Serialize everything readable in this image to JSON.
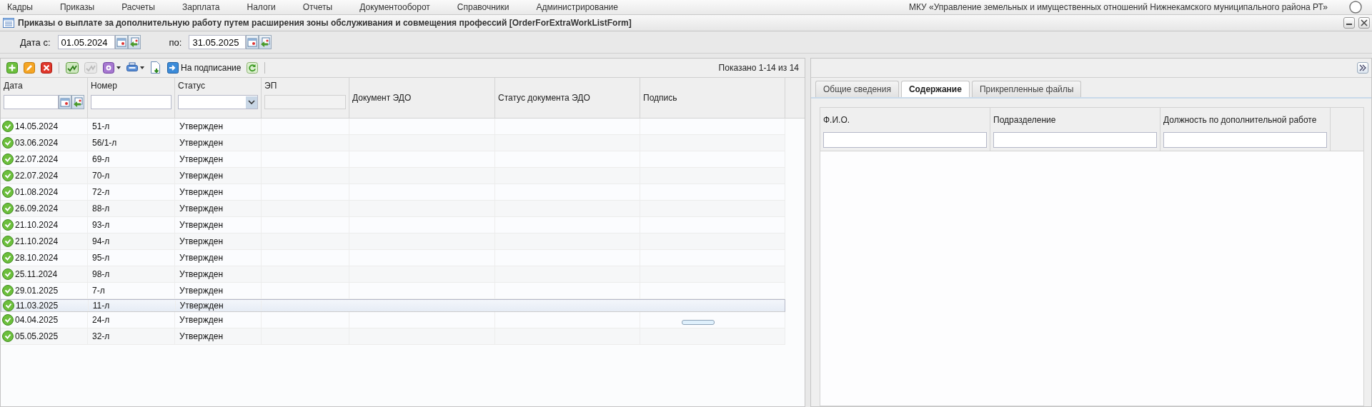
{
  "menu": [
    "Кадры",
    "Приказы",
    "Расчеты",
    "Зарплата",
    "Налоги",
    "Отчеты",
    "Документооборот",
    "Справочники",
    "Администрирование"
  ],
  "organization": "МКУ «Управление земельных и имущественных отношений Нижнекамского муниципального района РТ»",
  "window": {
    "title": "Приказы о выплате за дополнительную работу путем расширения зоны обслуживания и совмещения профессий [OrderForExtraWorkListForm]"
  },
  "filter": {
    "from_label": "Дата с:",
    "from": "01.05.2024",
    "to_label": "по:",
    "to": "31.05.2025"
  },
  "toolbar": [
    {
      "kind": "add",
      "disabled": false
    },
    {
      "kind": "edit",
      "disabled": false
    },
    {
      "kind": "delete",
      "disabled": false
    },
    {
      "kind": "separator"
    },
    {
      "kind": "sign",
      "disabled": false
    },
    {
      "kind": "sign",
      "disabled": true
    },
    {
      "kind": "settings",
      "disabled": false,
      "dropdown": true
    },
    {
      "kind": "print",
      "disabled": false,
      "dropdown": true
    },
    {
      "kind": "export",
      "disabled": false
    },
    {
      "kind": "send",
      "disabled": false,
      "label": "На подписание"
    },
    {
      "kind": "refresh",
      "disabled": false
    },
    {
      "kind": "separator"
    }
  ],
  "paging": "Показано 1-14 из 14",
  "table": {
    "columns": [
      {
        "label": "Дата",
        "kind": "date"
      },
      {
        "label": "Номер",
        "kind": "text"
      },
      {
        "label": "Статус",
        "kind": "select"
      },
      {
        "label": "ЭП",
        "kind": "locked"
      },
      {
        "label": "Документ ЭДО",
        "kind": "plain"
      },
      {
        "label": "Статус документа ЭДО",
        "kind": "plain"
      },
      {
        "label": "Подпись",
        "kind": "plain"
      }
    ],
    "rows": [
      {
        "date": "14.05.2024",
        "number": "51-л",
        "status": "Утвержден",
        "selected": false
      },
      {
        "date": "03.06.2024",
        "number": "56/1-л",
        "status": "Утвержден",
        "selected": false
      },
      {
        "date": "22.07.2024",
        "number": "69-л",
        "status": "Утвержден",
        "selected": false
      },
      {
        "date": "22.07.2024",
        "number": "70-л",
        "status": "Утвержден",
        "selected": false
      },
      {
        "date": "01.08.2024",
        "number": "72-л",
        "status": "Утвержден",
        "selected": false
      },
      {
        "date": "26.09.2024",
        "number": "88-л",
        "status": "Утвержден",
        "selected": false
      },
      {
        "date": "21.10.2024",
        "number": "93-л",
        "status": "Утвержден",
        "selected": false
      },
      {
        "date": "21.10.2024",
        "number": "94-л",
        "status": "Утвержден",
        "selected": false
      },
      {
        "date": "28.10.2024",
        "number": "95-л",
        "status": "Утвержден",
        "selected": false
      },
      {
        "date": "25.11.2024",
        "number": "98-л",
        "status": "Утвержден",
        "selected": false
      },
      {
        "date": "29.01.2025",
        "number": "7-л",
        "status": "Утвержден",
        "selected": false
      },
      {
        "date": "11.03.2025",
        "number": "11-л",
        "status": "Утвержден",
        "selected": true
      },
      {
        "date": "04.04.2025",
        "number": "24-л",
        "status": "Утвержден",
        "selected": false
      },
      {
        "date": "05.05.2025",
        "number": "32-л",
        "status": "Утвержден",
        "selected": false
      }
    ]
  },
  "detail": {
    "tabs": [
      {
        "label": "Общие сведения",
        "selected": false
      },
      {
        "label": "Содержание",
        "selected": true
      },
      {
        "label": "Прикрепленные файлы",
        "selected": false
      }
    ],
    "columns": [
      "Ф.И.О.",
      "Подразделение",
      "Должность по дополнительной работе"
    ]
  }
}
